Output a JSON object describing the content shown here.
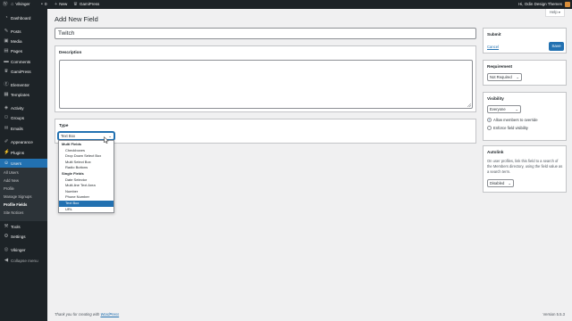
{
  "adminbar": {
    "site_name": "Vikinger",
    "comments_count": "0",
    "new_label": "New",
    "gamipress_label": "GamiPress",
    "greeting": "Hi, Odin Design Themes"
  },
  "sidebar": {
    "items": [
      {
        "label": "Dashboard",
        "icon": "dashboard-icon"
      },
      {
        "label": "Posts",
        "icon": "pin-icon"
      },
      {
        "label": "Media",
        "icon": "media-icon"
      },
      {
        "label": "Pages",
        "icon": "page-icon"
      },
      {
        "label": "Comments",
        "icon": "comment-icon"
      },
      {
        "label": "GamiPress",
        "icon": "trophy-icon"
      },
      {
        "label": "Elementor",
        "icon": "elementor-icon"
      },
      {
        "label": "Templates",
        "icon": "folder-icon"
      },
      {
        "label": "Activity",
        "icon": "activity-icon"
      },
      {
        "label": "Groups",
        "icon": "groups-icon"
      },
      {
        "label": "Emails",
        "icon": "email-icon"
      },
      {
        "label": "Appearance",
        "icon": "brush-icon"
      },
      {
        "label": "Plugins",
        "icon": "plug-icon"
      },
      {
        "label": "Users",
        "icon": "users-icon"
      },
      {
        "label": "Tools",
        "icon": "wrench-icon"
      },
      {
        "label": "Settings",
        "icon": "settings-icon"
      },
      {
        "label": "Vikinger",
        "icon": "vikinger-icon"
      },
      {
        "label": "Collapse menu",
        "icon": "collapse-icon"
      }
    ],
    "submenu": [
      "All Users",
      "Add New",
      "Profile",
      "Manage Signups",
      "Profile Fields",
      "Site Notices"
    ]
  },
  "help_label": "Help ▾",
  "page": {
    "title": "Add New Field",
    "name_value": "Twitch"
  },
  "description": {
    "title": "Description"
  },
  "type": {
    "title": "Type",
    "selected": "Text Box",
    "options": [
      {
        "label": "Multi Fields",
        "kind": "group"
      },
      {
        "label": "Checkboxes",
        "kind": "opt"
      },
      {
        "label": "Drop Down Select Box",
        "kind": "opt"
      },
      {
        "label": "Multi Select Box",
        "kind": "opt"
      },
      {
        "label": "Radio Buttons",
        "kind": "opt"
      },
      {
        "label": "Single Fields",
        "kind": "group"
      },
      {
        "label": "Date Selector",
        "kind": "opt"
      },
      {
        "label": "Multi-line Text Area",
        "kind": "opt"
      },
      {
        "label": "Number",
        "kind": "opt"
      },
      {
        "label": "Phone Number",
        "kind": "opt"
      },
      {
        "label": "Text Box",
        "kind": "opt",
        "selected": true
      },
      {
        "label": "URL",
        "kind": "opt"
      }
    ]
  },
  "submit": {
    "title": "Submit",
    "cancel": "Cancel",
    "save": "Save"
  },
  "requirement": {
    "title": "Requirement",
    "value": "Not Required"
  },
  "visibility": {
    "title": "Visibility",
    "value": "Everyone",
    "allow_override": "Allow members to override",
    "enforce": "Enforce field visibility"
  },
  "autolink": {
    "title": "Autolink",
    "description": "On user profiles, link this field to a search of the Members directory, using the field value as a search term.",
    "value": "Disabled"
  },
  "footer": {
    "thanks": "Thank you for creating with ",
    "wordpress": "WordPress",
    "version": "Version 5.5.3"
  },
  "colors": {
    "accent": "#2271b1",
    "sidebar": "#1d2327",
    "background": "#f0f0f1"
  }
}
